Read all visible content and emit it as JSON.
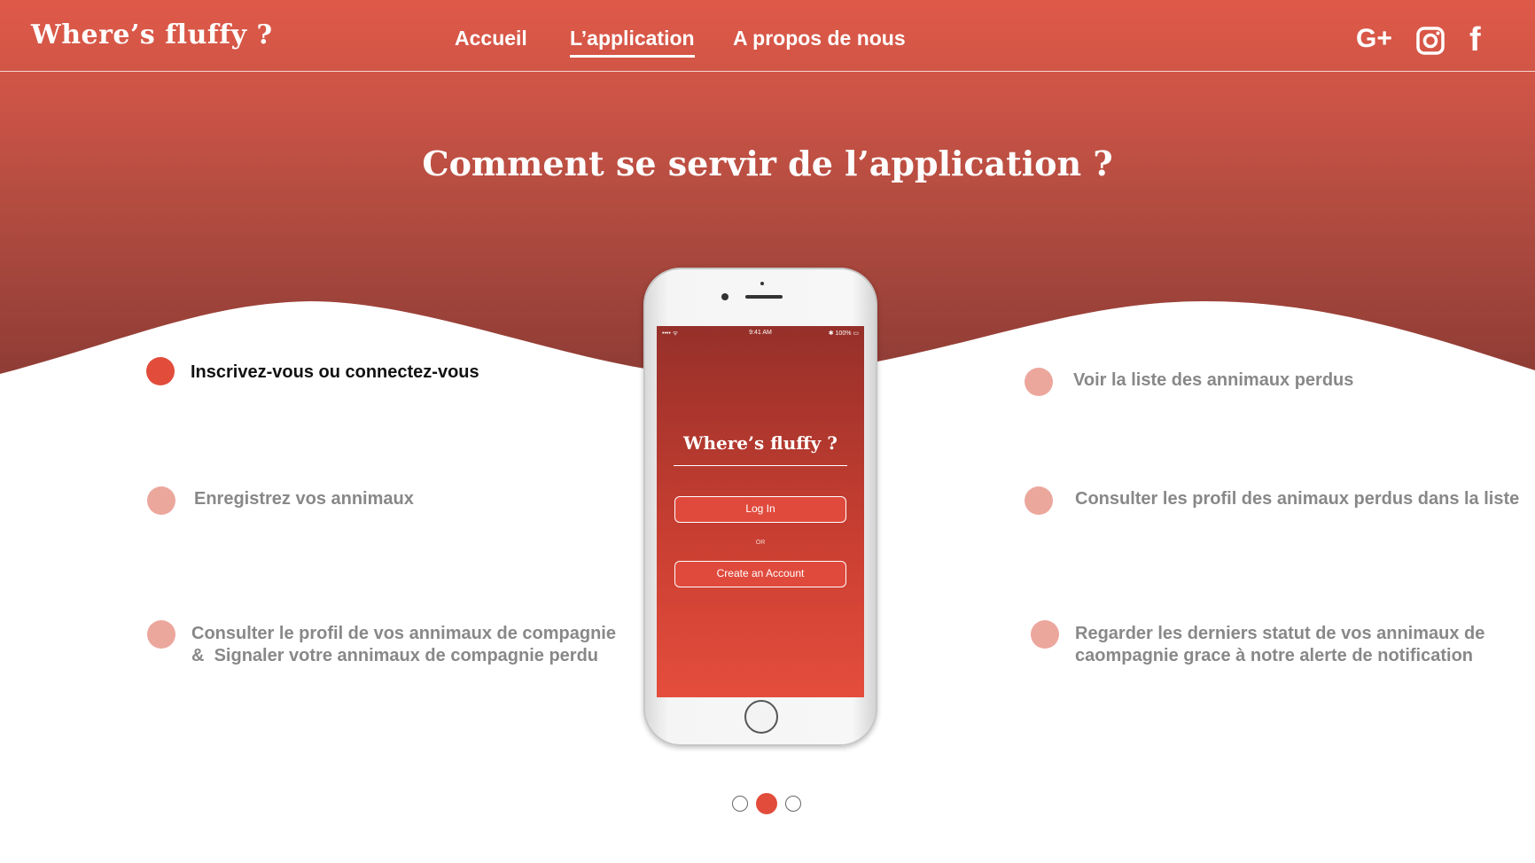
{
  "header": {
    "brand": "Where’s fluffy ?",
    "nav": [
      {
        "label": "Accueil",
        "active": false
      },
      {
        "label": "L’application",
        "active": true
      },
      {
        "label": "A propos de nous",
        "active": false
      }
    ],
    "social": {
      "gplus": "G+",
      "facebook": "f",
      "instagram_icon": "instagram-icon"
    }
  },
  "hero": {
    "title": "Comment se servir de l’application ?",
    "colors": {
      "top": "#df5948",
      "bottom": "#8b3b34",
      "accent": "#e24c3b"
    }
  },
  "phone": {
    "status": {
      "signal": "•••• ᯤ",
      "time": "9:41 AM",
      "battery": "✱ 100% ▭"
    },
    "brand": "Where’s fluffy ?",
    "login_label": "Log In",
    "or_label": "OR",
    "create_label": "Create an Account"
  },
  "steps": {
    "left": [
      {
        "text": "Inscrivez-vous ou connectez-vous",
        "active": true
      },
      {
        "text": "Enregistrez vos annimaux",
        "active": false
      },
      {
        "line1": "Consulter le profil de vos annimaux de compagnie",
        "amp": "&",
        "line2": "Signaler votre annimaux de compagnie perdu",
        "active": false
      }
    ],
    "right": [
      {
        "text": "Voir la liste des annimaux perdus",
        "active": false
      },
      {
        "text": "Consulter les profil des animaux perdus dans la liste",
        "active": false
      },
      {
        "line1": "Regarder les derniers statut de vos annimaux de",
        "line2": "caompagnie grace à notre alerte de notification",
        "active": false
      }
    ]
  },
  "pager": {
    "count": 3,
    "current": 2
  }
}
